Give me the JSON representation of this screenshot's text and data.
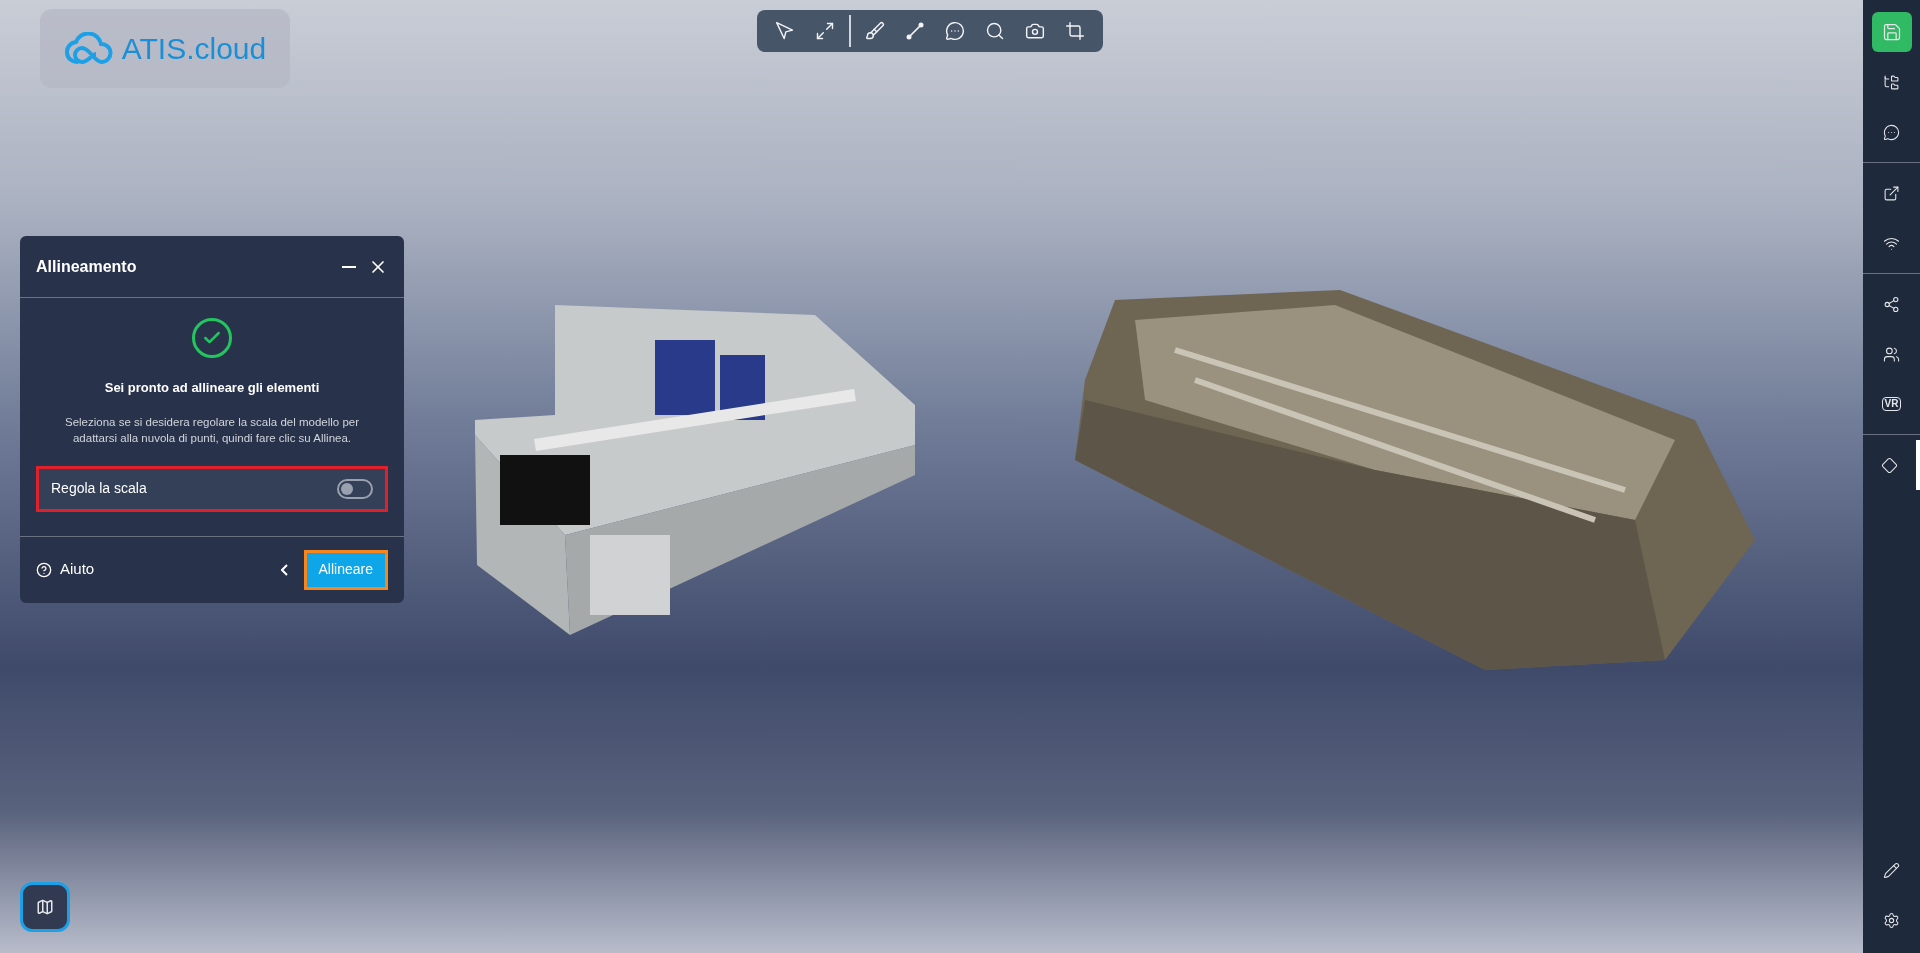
{
  "logo": {
    "text": "ATIS.cloud"
  },
  "panel": {
    "title": "Allineamento",
    "heading": "Sei pronto ad allineare gli elementi",
    "description": "Seleziona se si desidera regolare la scala del modello per adattarsi alla nuvola di punti, quindi fare clic su Allinea.",
    "toggle": {
      "label": "Regola la scala",
      "on": false
    },
    "help": "Aiuto",
    "primary_button": "Allineare"
  },
  "sidebar": {
    "groups": [
      [
        {
          "kind": "save",
          "selected": false
        },
        {
          "kind": "tree",
          "selected": false
        },
        {
          "kind": "comment",
          "selected": false
        }
      ],
      [
        {
          "kind": "export",
          "selected": false
        },
        {
          "kind": "wifi",
          "selected": false
        }
      ],
      [
        {
          "kind": "share",
          "selected": false
        },
        {
          "kind": "users",
          "selected": false
        },
        {
          "kind": "vr",
          "label": "VR",
          "selected": false
        }
      ],
      [
        {
          "kind": "diamond",
          "selected": true
        }
      ]
    ],
    "bottom": [
      {
        "kind": "pencil",
        "selected": false
      },
      {
        "kind": "settings",
        "selected": false
      }
    ]
  }
}
